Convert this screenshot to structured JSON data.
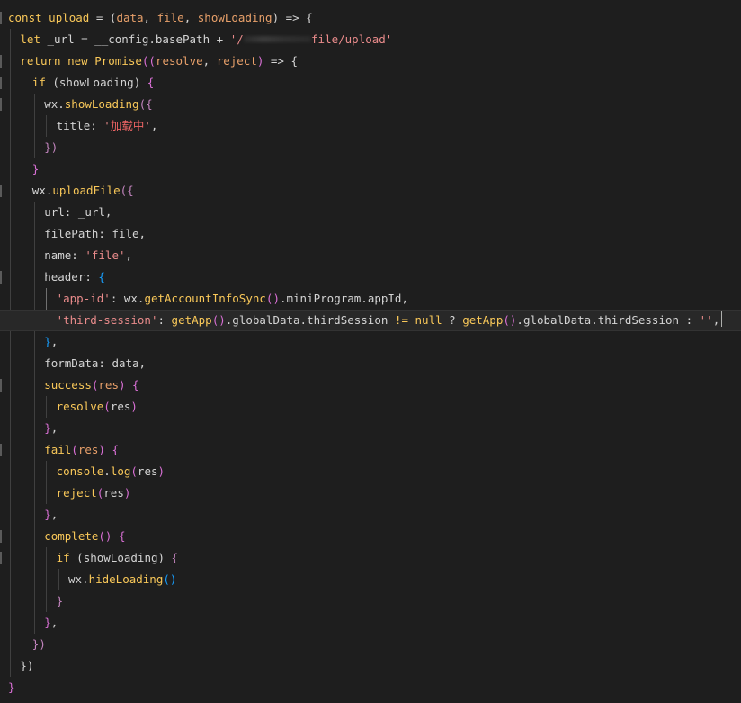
{
  "editor": {
    "lines": [
      {
        "indent": 0,
        "tokens": [
          [
            "kw",
            "const"
          ],
          [
            "p",
            " "
          ],
          [
            "fn",
            "upload"
          ],
          [
            "p",
            " = ("
          ],
          [
            "param",
            "data"
          ],
          [
            "p",
            ", "
          ],
          [
            "param",
            "file"
          ],
          [
            "p",
            ", "
          ],
          [
            "param",
            "showLoading"
          ],
          [
            "p",
            ") => {"
          ]
        ]
      },
      {
        "indent": 1,
        "tokens": [
          [
            "kw",
            "let"
          ],
          [
            "p",
            " _url = __config.basePath + "
          ],
          [
            "str",
            "'/"
          ],
          [
            "mask",
            "          "
          ],
          [
            "str",
            "file/upload'"
          ]
        ]
      },
      {
        "indent": 1,
        "tokens": [
          [
            "kw",
            "return"
          ],
          [
            "p",
            " "
          ],
          [
            "kw",
            "new"
          ],
          [
            "p",
            " "
          ],
          [
            "fn",
            "Promise"
          ],
          [
            "b1",
            "(("
          ],
          [
            "param",
            "resolve"
          ],
          [
            "p",
            ", "
          ],
          [
            "param",
            "reject"
          ],
          [
            "b1",
            ")"
          ],
          [
            "p",
            " => {"
          ]
        ]
      },
      {
        "indent": 2,
        "tokens": [
          [
            "kw",
            "if"
          ],
          [
            "p",
            " (showLoading) "
          ],
          [
            "b1",
            "{"
          ]
        ]
      },
      {
        "indent": 3,
        "tokens": [
          [
            "p",
            "wx."
          ],
          [
            "fn",
            "showLoading"
          ],
          [
            "b2",
            "({"
          ]
        ]
      },
      {
        "indent": 4,
        "tokens": [
          [
            "p",
            "title: "
          ],
          [
            "str",
            "'"
          ],
          [
            "cn",
            "加载中"
          ],
          [
            "str",
            "'"
          ],
          [
            "p",
            ","
          ]
        ]
      },
      {
        "indent": 3,
        "tokens": [
          [
            "b2",
            "})"
          ]
        ]
      },
      {
        "indent": 2,
        "tokens": [
          [
            "b1",
            "}"
          ]
        ]
      },
      {
        "indent": 2,
        "tokens": [
          [
            "p",
            "wx."
          ],
          [
            "fn",
            "uploadFile"
          ],
          [
            "b2",
            "({"
          ]
        ]
      },
      {
        "indent": 3,
        "tokens": [
          [
            "p",
            "url: _url,"
          ]
        ]
      },
      {
        "indent": 3,
        "tokens": [
          [
            "p",
            "filePath: file,"
          ]
        ]
      },
      {
        "indent": 3,
        "tokens": [
          [
            "p",
            "name: "
          ],
          [
            "str",
            "'file'"
          ],
          [
            "p",
            ","
          ]
        ]
      },
      {
        "indent": 3,
        "tokens": [
          [
            "p",
            "header: "
          ],
          [
            "b3",
            "{"
          ]
        ]
      },
      {
        "indent": 4,
        "tokens": [
          [
            "str",
            "'app-id'"
          ],
          [
            "p",
            ": wx."
          ],
          [
            "fn",
            "getAccountInfoSync"
          ],
          [
            "b1",
            "()"
          ],
          [
            "p",
            ".miniProgram.appId,"
          ]
        ]
      },
      {
        "indent": 4,
        "current": true,
        "tokens": [
          [
            "str",
            "'third-session'"
          ],
          [
            "p",
            ": "
          ],
          [
            "fn",
            "getApp"
          ],
          [
            "b1",
            "()"
          ],
          [
            "p",
            ".globalData.thirdSession "
          ],
          [
            "kw",
            "!="
          ],
          [
            "p",
            " "
          ],
          [
            "kw",
            "null"
          ],
          [
            "p",
            " ? "
          ],
          [
            "fn",
            "getApp"
          ],
          [
            "b1",
            "()"
          ],
          [
            "p",
            ".globalData.thirdSession : "
          ],
          [
            "str",
            "''"
          ],
          [
            "p",
            ","
          ],
          [
            "cursor",
            ""
          ]
        ]
      },
      {
        "indent": 3,
        "tokens": [
          [
            "b3",
            "}"
          ],
          [
            "p",
            ","
          ]
        ]
      },
      {
        "indent": 3,
        "tokens": [
          [
            "p",
            "formData: data,"
          ]
        ]
      },
      {
        "indent": 3,
        "tokens": [
          [
            "fn",
            "success"
          ],
          [
            "b1",
            "("
          ],
          [
            "param",
            "res"
          ],
          [
            "b1",
            ")"
          ],
          [
            "p",
            " "
          ],
          [
            "b1",
            "{"
          ]
        ]
      },
      {
        "indent": 4,
        "tokens": [
          [
            "fn",
            "resolve"
          ],
          [
            "b1",
            "("
          ],
          [
            "p",
            "res"
          ],
          [
            "b1",
            ")"
          ]
        ]
      },
      {
        "indent": 3,
        "tokens": [
          [
            "b1",
            "}"
          ],
          [
            "p",
            ","
          ]
        ]
      },
      {
        "indent": 3,
        "tokens": [
          [
            "fn",
            "fail"
          ],
          [
            "b1",
            "("
          ],
          [
            "param",
            "res"
          ],
          [
            "b1",
            ")"
          ],
          [
            "p",
            " "
          ],
          [
            "b1",
            "{"
          ]
        ]
      },
      {
        "indent": 4,
        "tokens": [
          [
            "fn",
            "console"
          ],
          [
            "p",
            "."
          ],
          [
            "fn",
            "log"
          ],
          [
            "b1",
            "("
          ],
          [
            "p",
            "res"
          ],
          [
            "b1",
            ")"
          ]
        ]
      },
      {
        "indent": 4,
        "tokens": [
          [
            "fn",
            "reject"
          ],
          [
            "b1",
            "("
          ],
          [
            "p",
            "res"
          ],
          [
            "b1",
            ")"
          ]
        ]
      },
      {
        "indent": 3,
        "tokens": [
          [
            "b1",
            "}"
          ],
          [
            "p",
            ","
          ]
        ]
      },
      {
        "indent": 3,
        "tokens": [
          [
            "fn",
            "complete"
          ],
          [
            "b1",
            "()"
          ],
          [
            "p",
            " "
          ],
          [
            "b1",
            "{"
          ]
        ]
      },
      {
        "indent": 4,
        "tokens": [
          [
            "kw",
            "if"
          ],
          [
            "p",
            " (showLoading) "
          ],
          [
            "b2",
            "{"
          ]
        ]
      },
      {
        "indent": 5,
        "tokens": [
          [
            "p",
            "wx."
          ],
          [
            "fn",
            "hideLoading"
          ],
          [
            "b3",
            "()"
          ]
        ]
      },
      {
        "indent": 4,
        "tokens": [
          [
            "b2",
            "}"
          ]
        ]
      },
      {
        "indent": 3,
        "tokens": [
          [
            "b1",
            "}"
          ],
          [
            "p",
            ","
          ]
        ]
      },
      {
        "indent": 2,
        "tokens": [
          [
            "b2",
            "})"
          ]
        ]
      },
      {
        "indent": 1,
        "tokens": [
          [
            "p",
            "})"
          ]
        ]
      },
      {
        "indent": 0,
        "tokens": [
          [
            "b1",
            "}"
          ]
        ]
      }
    ]
  },
  "colors": {
    "background": "#1e1e1e",
    "kw": "#f9c859",
    "fn": "#f9c859",
    "param": "#e8a06a",
    "str": "#e98b8b",
    "cn": "#f06565",
    "p": "#d4d4d4",
    "b1": "#da70d6",
    "b2": "#c586c0",
    "b3": "#179fff"
  }
}
